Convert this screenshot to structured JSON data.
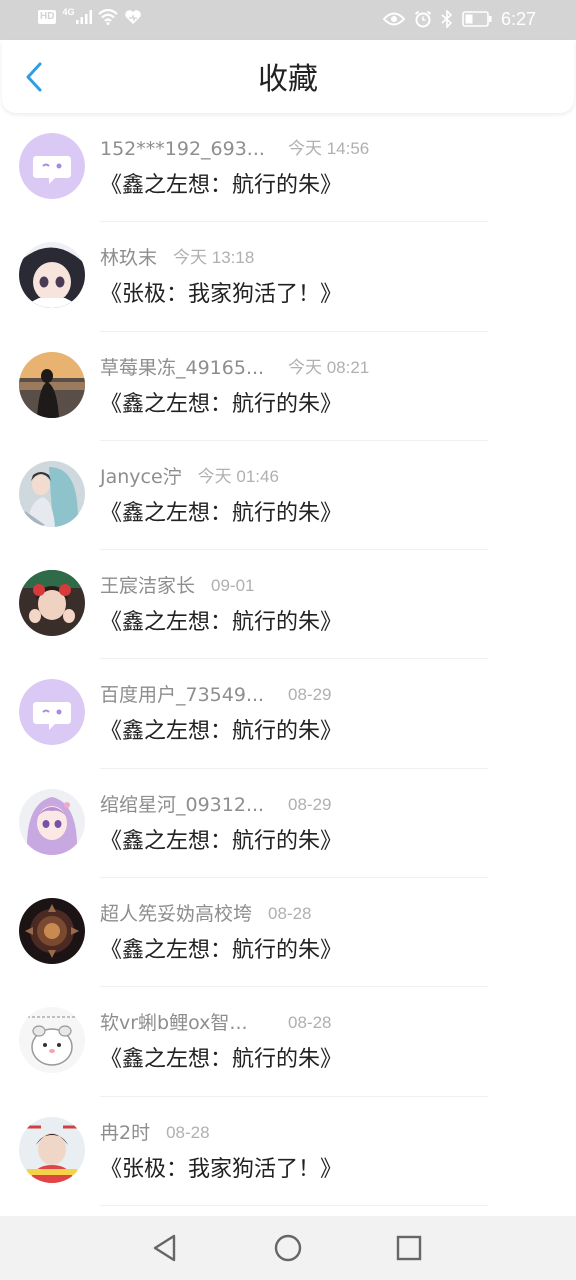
{
  "status_bar": {
    "hd_label": "HD",
    "network_label": "4G",
    "time": "6:27",
    "icons": [
      "signal-icon",
      "wifi-icon",
      "heart-icon",
      "eye-icon",
      "alarm-icon",
      "bluetooth-icon",
      "battery-icon"
    ]
  },
  "header": {
    "title": "收藏",
    "back_icon": "chevron-left-icon",
    "accent_color": "#2b9ee8"
  },
  "favorites": [
    {
      "user": "152***192_693...",
      "time": "今天 14:56",
      "title": "《鑫之左想：航行的朱》",
      "avatar": "default-chat-avatar"
    },
    {
      "user": "林玖末",
      "time": "今天 13:18",
      "title": "《张极：我家狗活了！》",
      "avatar": "anime-girl-avatar"
    },
    {
      "user": "草莓果冻_49165...",
      "time": "今天 08:21",
      "title": "《鑫之左想：航行的朱》",
      "avatar": "sunset-silhouette-avatar"
    },
    {
      "user": "Janyce泞",
      "time": "今天 01:46",
      "title": "《鑫之左想：航行的朱》",
      "avatar": "blue-hair-girl-avatar"
    },
    {
      "user": "王宸洁家长",
      "time": "09-01",
      "title": "《鑫之左想：航行的朱》",
      "avatar": "child-photo-avatar"
    },
    {
      "user": "百度用户_73549...",
      "time": "08-29",
      "title": "《鑫之左想：航行的朱》",
      "avatar": "default-chat-avatar"
    },
    {
      "user": "绾绾星河_09312...",
      "time": "08-29",
      "title": "《鑫之左想：航行的朱》",
      "avatar": "purple-hair-anime-avatar"
    },
    {
      "user": "超人筅妥妫高校垮",
      "time": "08-28",
      "title": "《鑫之左想：航行的朱》",
      "avatar": "dark-emblem-avatar"
    },
    {
      "user": "软vr蜊b鲤ox智...",
      "time": "08-28",
      "title": "《鑫之左想：航行的朱》",
      "avatar": "hamster-sketch-avatar"
    },
    {
      "user": "冉2时",
      "time": "08-28",
      "title": "《张极：我家狗活了！》",
      "avatar": "boy-photo-avatar"
    }
  ],
  "nav_bar": {
    "icons": [
      "back-triangle-icon",
      "home-circle-icon",
      "recents-square-icon"
    ]
  }
}
